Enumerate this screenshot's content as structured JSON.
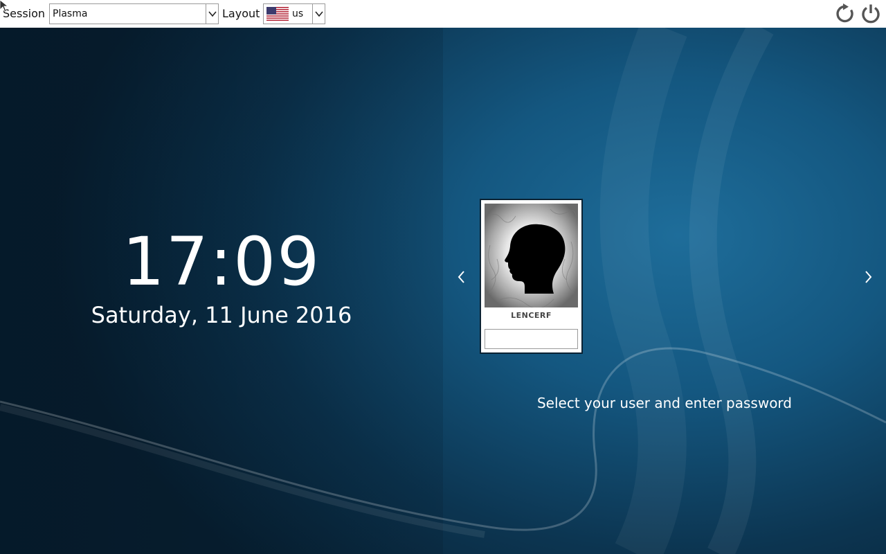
{
  "topbar": {
    "session_label": "Session",
    "session_value": "Plasma",
    "layout_label": "Layout",
    "layout_value": "us",
    "layout_flag_icon": "us-flag-icon",
    "restart_icon": "restart-icon",
    "shutdown_icon": "power-icon"
  },
  "clock": {
    "time": "17:09",
    "date": "Saturday, 11 June 2016"
  },
  "user_card": {
    "username": "LENCERF",
    "avatar_icon": "user-head-silhouette-icon",
    "password_value": ""
  },
  "navigation": {
    "prev_icon": "chevron-left-icon",
    "next_icon": "chevron-right-icon"
  },
  "hint": "Select your user and enter password",
  "colors": {
    "background_dark": "#082235",
    "background_light": "#1e6d9a",
    "text": "#ffffff"
  }
}
